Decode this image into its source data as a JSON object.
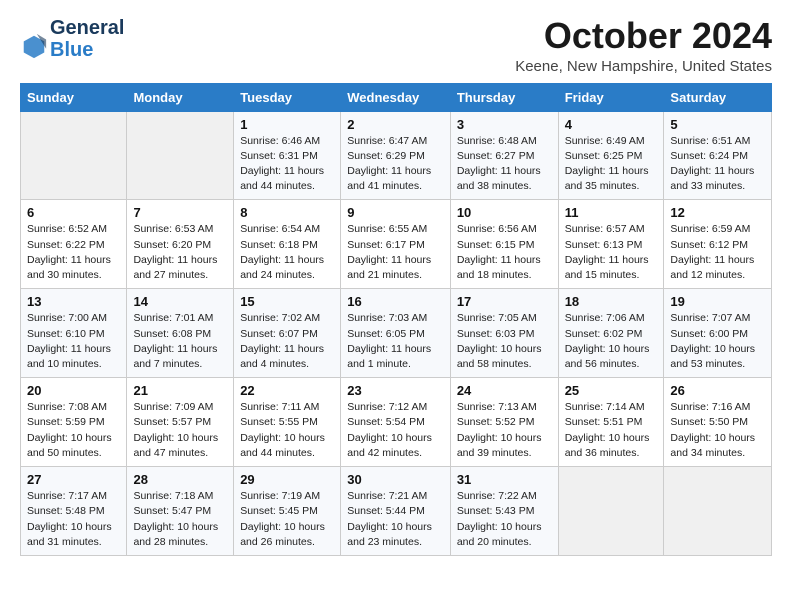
{
  "header": {
    "logo_general": "General",
    "logo_blue": "Blue",
    "month_title": "October 2024",
    "location": "Keene, New Hampshire, United States"
  },
  "weekdays": [
    "Sunday",
    "Monday",
    "Tuesday",
    "Wednesday",
    "Thursday",
    "Friday",
    "Saturday"
  ],
  "weeks": [
    [
      {
        "day": "",
        "sunrise": "",
        "sunset": "",
        "daylight": "",
        "empty": true
      },
      {
        "day": "",
        "sunrise": "",
        "sunset": "",
        "daylight": "",
        "empty": true
      },
      {
        "day": "1",
        "sunrise": "Sunrise: 6:46 AM",
        "sunset": "Sunset: 6:31 PM",
        "daylight": "Daylight: 11 hours and 44 minutes."
      },
      {
        "day": "2",
        "sunrise": "Sunrise: 6:47 AM",
        "sunset": "Sunset: 6:29 PM",
        "daylight": "Daylight: 11 hours and 41 minutes."
      },
      {
        "day": "3",
        "sunrise": "Sunrise: 6:48 AM",
        "sunset": "Sunset: 6:27 PM",
        "daylight": "Daylight: 11 hours and 38 minutes."
      },
      {
        "day": "4",
        "sunrise": "Sunrise: 6:49 AM",
        "sunset": "Sunset: 6:25 PM",
        "daylight": "Daylight: 11 hours and 35 minutes."
      },
      {
        "day": "5",
        "sunrise": "Sunrise: 6:51 AM",
        "sunset": "Sunset: 6:24 PM",
        "daylight": "Daylight: 11 hours and 33 minutes."
      }
    ],
    [
      {
        "day": "6",
        "sunrise": "Sunrise: 6:52 AM",
        "sunset": "Sunset: 6:22 PM",
        "daylight": "Daylight: 11 hours and 30 minutes."
      },
      {
        "day": "7",
        "sunrise": "Sunrise: 6:53 AM",
        "sunset": "Sunset: 6:20 PM",
        "daylight": "Daylight: 11 hours and 27 minutes."
      },
      {
        "day": "8",
        "sunrise": "Sunrise: 6:54 AM",
        "sunset": "Sunset: 6:18 PM",
        "daylight": "Daylight: 11 hours and 24 minutes."
      },
      {
        "day": "9",
        "sunrise": "Sunrise: 6:55 AM",
        "sunset": "Sunset: 6:17 PM",
        "daylight": "Daylight: 11 hours and 21 minutes."
      },
      {
        "day": "10",
        "sunrise": "Sunrise: 6:56 AM",
        "sunset": "Sunset: 6:15 PM",
        "daylight": "Daylight: 11 hours and 18 minutes."
      },
      {
        "day": "11",
        "sunrise": "Sunrise: 6:57 AM",
        "sunset": "Sunset: 6:13 PM",
        "daylight": "Daylight: 11 hours and 15 minutes."
      },
      {
        "day": "12",
        "sunrise": "Sunrise: 6:59 AM",
        "sunset": "Sunset: 6:12 PM",
        "daylight": "Daylight: 11 hours and 12 minutes."
      }
    ],
    [
      {
        "day": "13",
        "sunrise": "Sunrise: 7:00 AM",
        "sunset": "Sunset: 6:10 PM",
        "daylight": "Daylight: 11 hours and 10 minutes."
      },
      {
        "day": "14",
        "sunrise": "Sunrise: 7:01 AM",
        "sunset": "Sunset: 6:08 PM",
        "daylight": "Daylight: 11 hours and 7 minutes."
      },
      {
        "day": "15",
        "sunrise": "Sunrise: 7:02 AM",
        "sunset": "Sunset: 6:07 PM",
        "daylight": "Daylight: 11 hours and 4 minutes."
      },
      {
        "day": "16",
        "sunrise": "Sunrise: 7:03 AM",
        "sunset": "Sunset: 6:05 PM",
        "daylight": "Daylight: 11 hours and 1 minute."
      },
      {
        "day": "17",
        "sunrise": "Sunrise: 7:05 AM",
        "sunset": "Sunset: 6:03 PM",
        "daylight": "Daylight: 10 hours and 58 minutes."
      },
      {
        "day": "18",
        "sunrise": "Sunrise: 7:06 AM",
        "sunset": "Sunset: 6:02 PM",
        "daylight": "Daylight: 10 hours and 56 minutes."
      },
      {
        "day": "19",
        "sunrise": "Sunrise: 7:07 AM",
        "sunset": "Sunset: 6:00 PM",
        "daylight": "Daylight: 10 hours and 53 minutes."
      }
    ],
    [
      {
        "day": "20",
        "sunrise": "Sunrise: 7:08 AM",
        "sunset": "Sunset: 5:59 PM",
        "daylight": "Daylight: 10 hours and 50 minutes."
      },
      {
        "day": "21",
        "sunrise": "Sunrise: 7:09 AM",
        "sunset": "Sunset: 5:57 PM",
        "daylight": "Daylight: 10 hours and 47 minutes."
      },
      {
        "day": "22",
        "sunrise": "Sunrise: 7:11 AM",
        "sunset": "Sunset: 5:55 PM",
        "daylight": "Daylight: 10 hours and 44 minutes."
      },
      {
        "day": "23",
        "sunrise": "Sunrise: 7:12 AM",
        "sunset": "Sunset: 5:54 PM",
        "daylight": "Daylight: 10 hours and 42 minutes."
      },
      {
        "day": "24",
        "sunrise": "Sunrise: 7:13 AM",
        "sunset": "Sunset: 5:52 PM",
        "daylight": "Daylight: 10 hours and 39 minutes."
      },
      {
        "day": "25",
        "sunrise": "Sunrise: 7:14 AM",
        "sunset": "Sunset: 5:51 PM",
        "daylight": "Daylight: 10 hours and 36 minutes."
      },
      {
        "day": "26",
        "sunrise": "Sunrise: 7:16 AM",
        "sunset": "Sunset: 5:50 PM",
        "daylight": "Daylight: 10 hours and 34 minutes."
      }
    ],
    [
      {
        "day": "27",
        "sunrise": "Sunrise: 7:17 AM",
        "sunset": "Sunset: 5:48 PM",
        "daylight": "Daylight: 10 hours and 31 minutes."
      },
      {
        "day": "28",
        "sunrise": "Sunrise: 7:18 AM",
        "sunset": "Sunset: 5:47 PM",
        "daylight": "Daylight: 10 hours and 28 minutes."
      },
      {
        "day": "29",
        "sunrise": "Sunrise: 7:19 AM",
        "sunset": "Sunset: 5:45 PM",
        "daylight": "Daylight: 10 hours and 26 minutes."
      },
      {
        "day": "30",
        "sunrise": "Sunrise: 7:21 AM",
        "sunset": "Sunset: 5:44 PM",
        "daylight": "Daylight: 10 hours and 23 minutes."
      },
      {
        "day": "31",
        "sunrise": "Sunrise: 7:22 AM",
        "sunset": "Sunset: 5:43 PM",
        "daylight": "Daylight: 10 hours and 20 minutes."
      },
      {
        "day": "",
        "sunrise": "",
        "sunset": "",
        "daylight": "",
        "empty": true
      },
      {
        "day": "",
        "sunrise": "",
        "sunset": "",
        "daylight": "",
        "empty": true
      }
    ]
  ]
}
